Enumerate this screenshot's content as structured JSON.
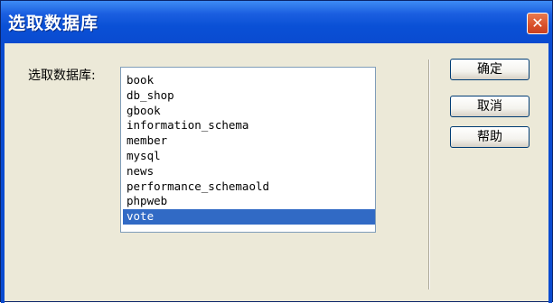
{
  "window": {
    "title": "选取数据库",
    "close_glyph": "✕"
  },
  "form": {
    "label": "选取数据库:",
    "databases": [
      "book",
      "db_shop",
      "gbook",
      "information_schema",
      "member",
      "mysql",
      "news",
      "performance_schemaold",
      "phpweb",
      "vote"
    ],
    "selected": "vote"
  },
  "buttons": {
    "ok": "确定",
    "cancel": "取消",
    "help": "帮助"
  },
  "colors": {
    "title_bar": "#0a4bd0",
    "selection": "#316ac5",
    "dialog_bg": "#ece9d8",
    "close_button": "#d9502a"
  }
}
